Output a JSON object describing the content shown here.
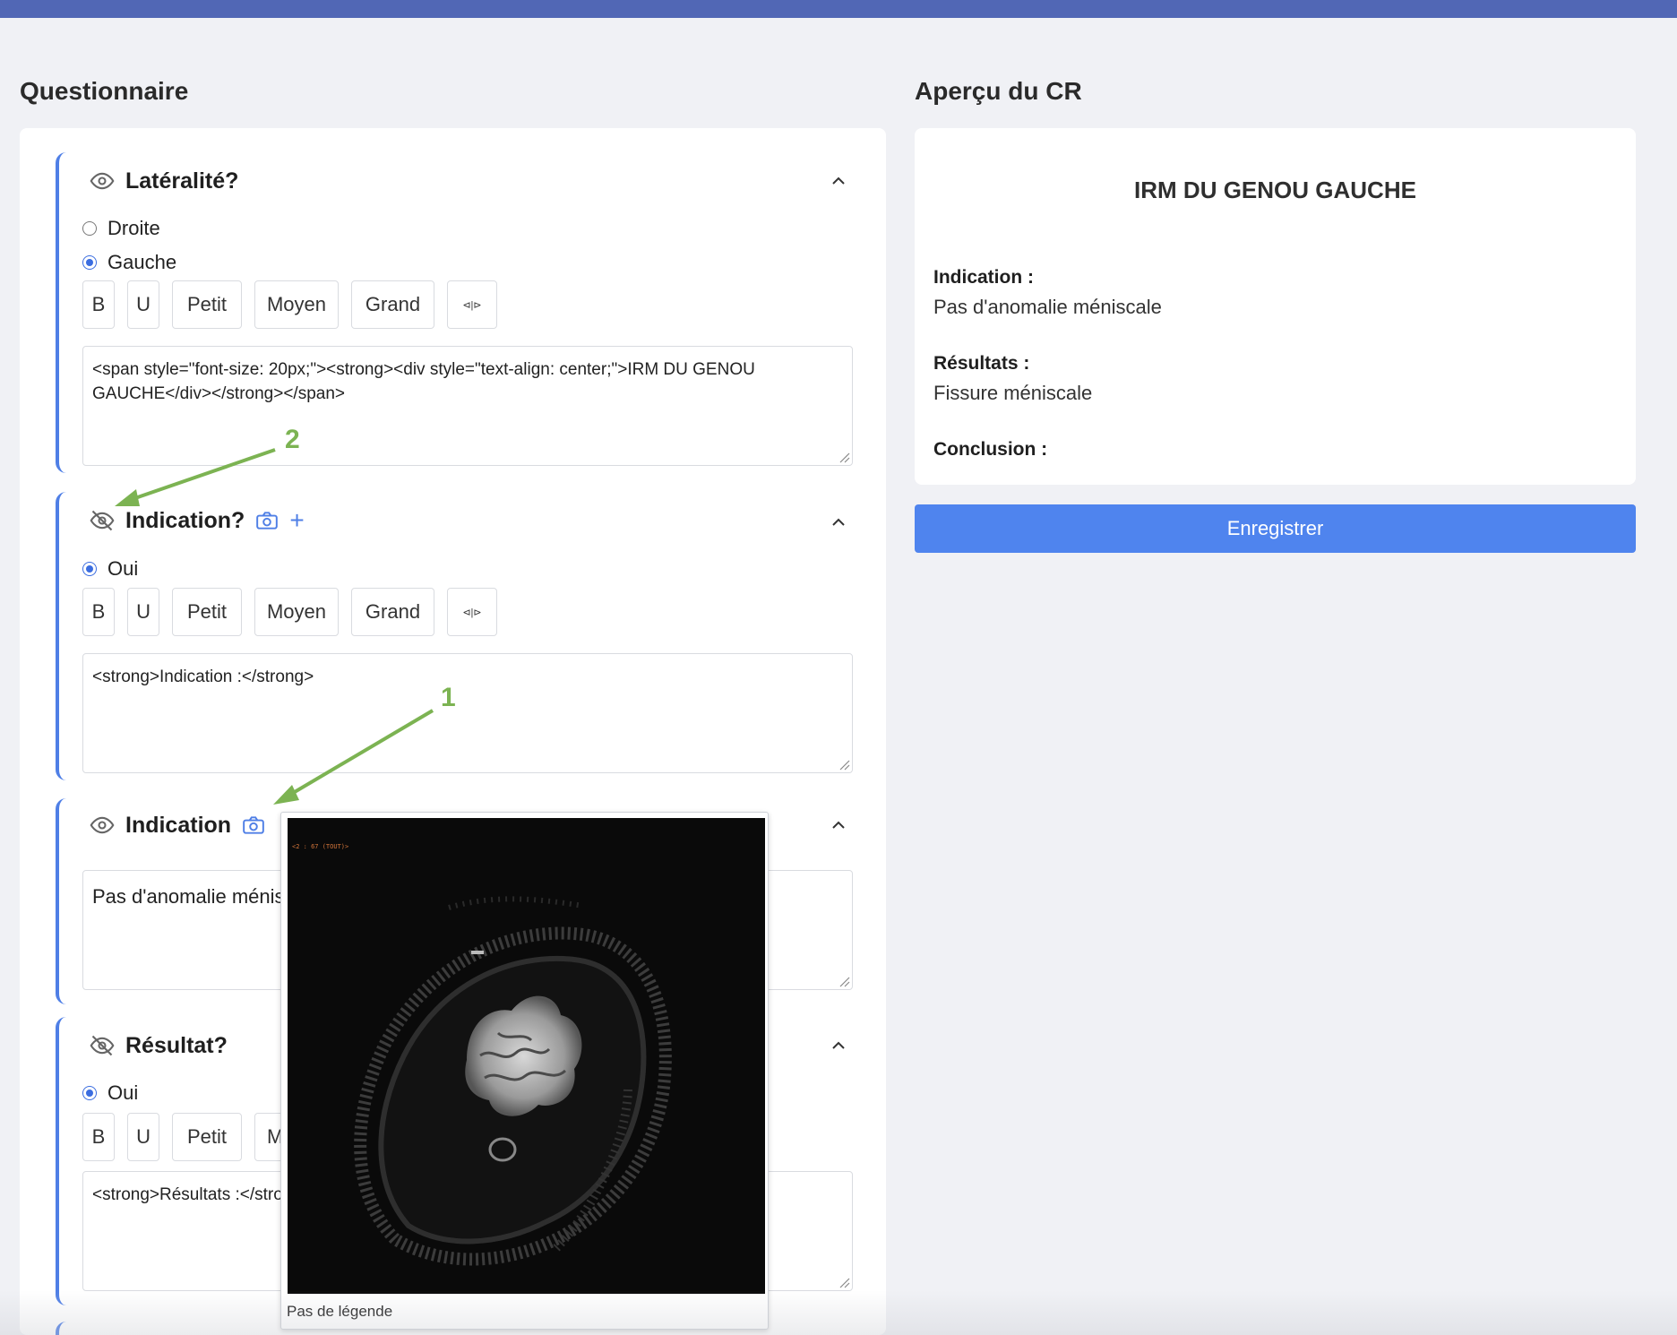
{
  "questionnaire": {
    "title": "Questionnaire",
    "sections": [
      {
        "title": "Latéralité?",
        "visible": true,
        "options": [
          {
            "label": "Droite",
            "checked": false
          },
          {
            "label": "Gauche",
            "checked": true
          }
        ],
        "toolbar": [
          "B",
          "U",
          "Petit",
          "Moyen",
          "Grand",
          "⊲|⊳"
        ],
        "textarea": "<span style=\"font-size: 20px;\"><strong><div style=\"text-align: center;\">IRM DU GENOU GAUCHE</div></strong></span>"
      },
      {
        "title": "Indication?",
        "visible": false,
        "has_camera": true,
        "has_add": true,
        "add_label": "+",
        "options": [
          {
            "label": "Oui",
            "checked": true
          }
        ],
        "toolbar": [
          "B",
          "U",
          "Petit",
          "Moyen",
          "Grand",
          "⊲|⊳"
        ],
        "textarea": "<strong>Indication :</strong>"
      },
      {
        "title": "Indication",
        "visible": true,
        "has_camera": true,
        "textarea": "Pas d'anomalie méniscale"
      },
      {
        "title": "Résultat?",
        "visible": false,
        "options": [
          {
            "label": "Oui",
            "checked": true
          }
        ],
        "toolbar": [
          "B",
          "U",
          "Petit",
          "Moyen"
        ],
        "textarea": "<strong>Résultats :</strong>"
      }
    ]
  },
  "preview": {
    "title": "Aperçu du CR",
    "report_title": "IRM DU GENOU GAUCHE",
    "blocks": [
      {
        "label": "Indication :",
        "text": "Pas d'anomalie méniscale"
      },
      {
        "label": "Résultats :",
        "text": "Fissure méniscale"
      },
      {
        "label": "Conclusion :",
        "text": ""
      }
    ],
    "save_label": "Enregistrer"
  },
  "image_popup": {
    "overlay_text": "<2 : 67 (TOUT)>",
    "caption": "Pas de légende"
  },
  "annotations": {
    "arrow1": "1",
    "arrow2": "2",
    "color": "#7cb352"
  },
  "colors": {
    "accent": "#4f84ee",
    "topbar": "#5167b5",
    "section_border": "#4f7fe6"
  }
}
